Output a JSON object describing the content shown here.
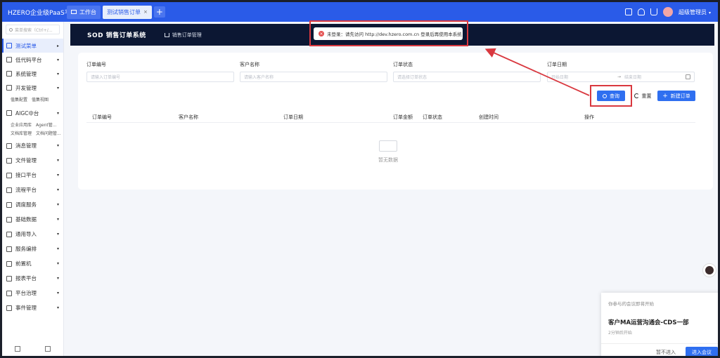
{
  "topbar": {
    "brand": "HZERO企业级PaaS平台",
    "tabs": [
      {
        "label": "工作台"
      },
      {
        "label": "测试销售订单",
        "close": "×"
      }
    ],
    "add": "+",
    "user": "超级管理员",
    "user_caret": "▾"
  },
  "sidebar": {
    "search_placeholder": "菜单搜索（Ctrl+/...",
    "items": [
      {
        "label": "测试菜单",
        "arrow": "▸"
      },
      {
        "label": "低代码平台",
        "arrow": "▾"
      },
      {
        "label": "系统管理",
        "arrow": "▾"
      },
      {
        "label": "开发管理",
        "arrow": "▾"
      }
    ],
    "sub_dev": [
      "值集配置",
      "值集视图"
    ],
    "aigc": {
      "label": "AIGC中台",
      "arrow": "▾"
    },
    "sub_aigc_1": [
      "企业应用库",
      "Agent管..."
    ],
    "sub_aigc_2": [
      "文档库管理",
      "文档问题管..."
    ],
    "items2": [
      {
        "label": "消息管理",
        "arrow": "▾"
      },
      {
        "label": "文件管理",
        "arrow": "▾"
      },
      {
        "label": "接口平台",
        "arrow": "▾"
      },
      {
        "label": "流程平台",
        "arrow": "▾"
      },
      {
        "label": "调度服务",
        "arrow": "▾"
      },
      {
        "label": "基础数据",
        "arrow": "▾"
      },
      {
        "label": "通用导入",
        "arrow": "▾"
      },
      {
        "label": "服务编排",
        "arrow": "▾"
      },
      {
        "label": "前置机",
        "arrow": "▾"
      },
      {
        "label": "报表平台",
        "arrow": "▾"
      },
      {
        "label": "平台治理",
        "arrow": "▾"
      },
      {
        "label": "事件管理",
        "arrow": "▾"
      }
    ]
  },
  "app": {
    "title": "SOD 销售订单系统",
    "nav": "销售订单管理"
  },
  "toast": {
    "icon": "×",
    "text": "未登录：请先访问 http://dev.hzero.com.cn 登录后再使用本系统"
  },
  "filters": {
    "order_no": {
      "label": "订单编号",
      "placeholder": "请输入订单编号"
    },
    "customer": {
      "label": "客户名称",
      "placeholder": "请输入客户名称"
    },
    "status": {
      "label": "订单状态",
      "placeholder": "请选择订单状态"
    },
    "date": {
      "label": "订单日期",
      "start": "开始日期",
      "sep": "→",
      "end": "结束日期"
    }
  },
  "buttons": {
    "query": "查询",
    "reset": "重置",
    "add": "新建订单"
  },
  "table": {
    "headers": [
      "订单编号",
      "客户名称",
      "订单日期",
      "订单金额",
      "订单状态",
      "创建时间",
      "操作"
    ],
    "empty": "暂无数据"
  },
  "notice": {
    "head": "你参与的会议即将开始",
    "title": "客户MA运营沟通会-CDS一部",
    "sub": "2分钟后开始",
    "ignore": "暂不进入",
    "enter": "进入会议"
  },
  "colors": {
    "primary": "#2a5be8",
    "button": "#2f6ff0",
    "appbar": "#0c1733",
    "highlight": "#d9383f"
  }
}
